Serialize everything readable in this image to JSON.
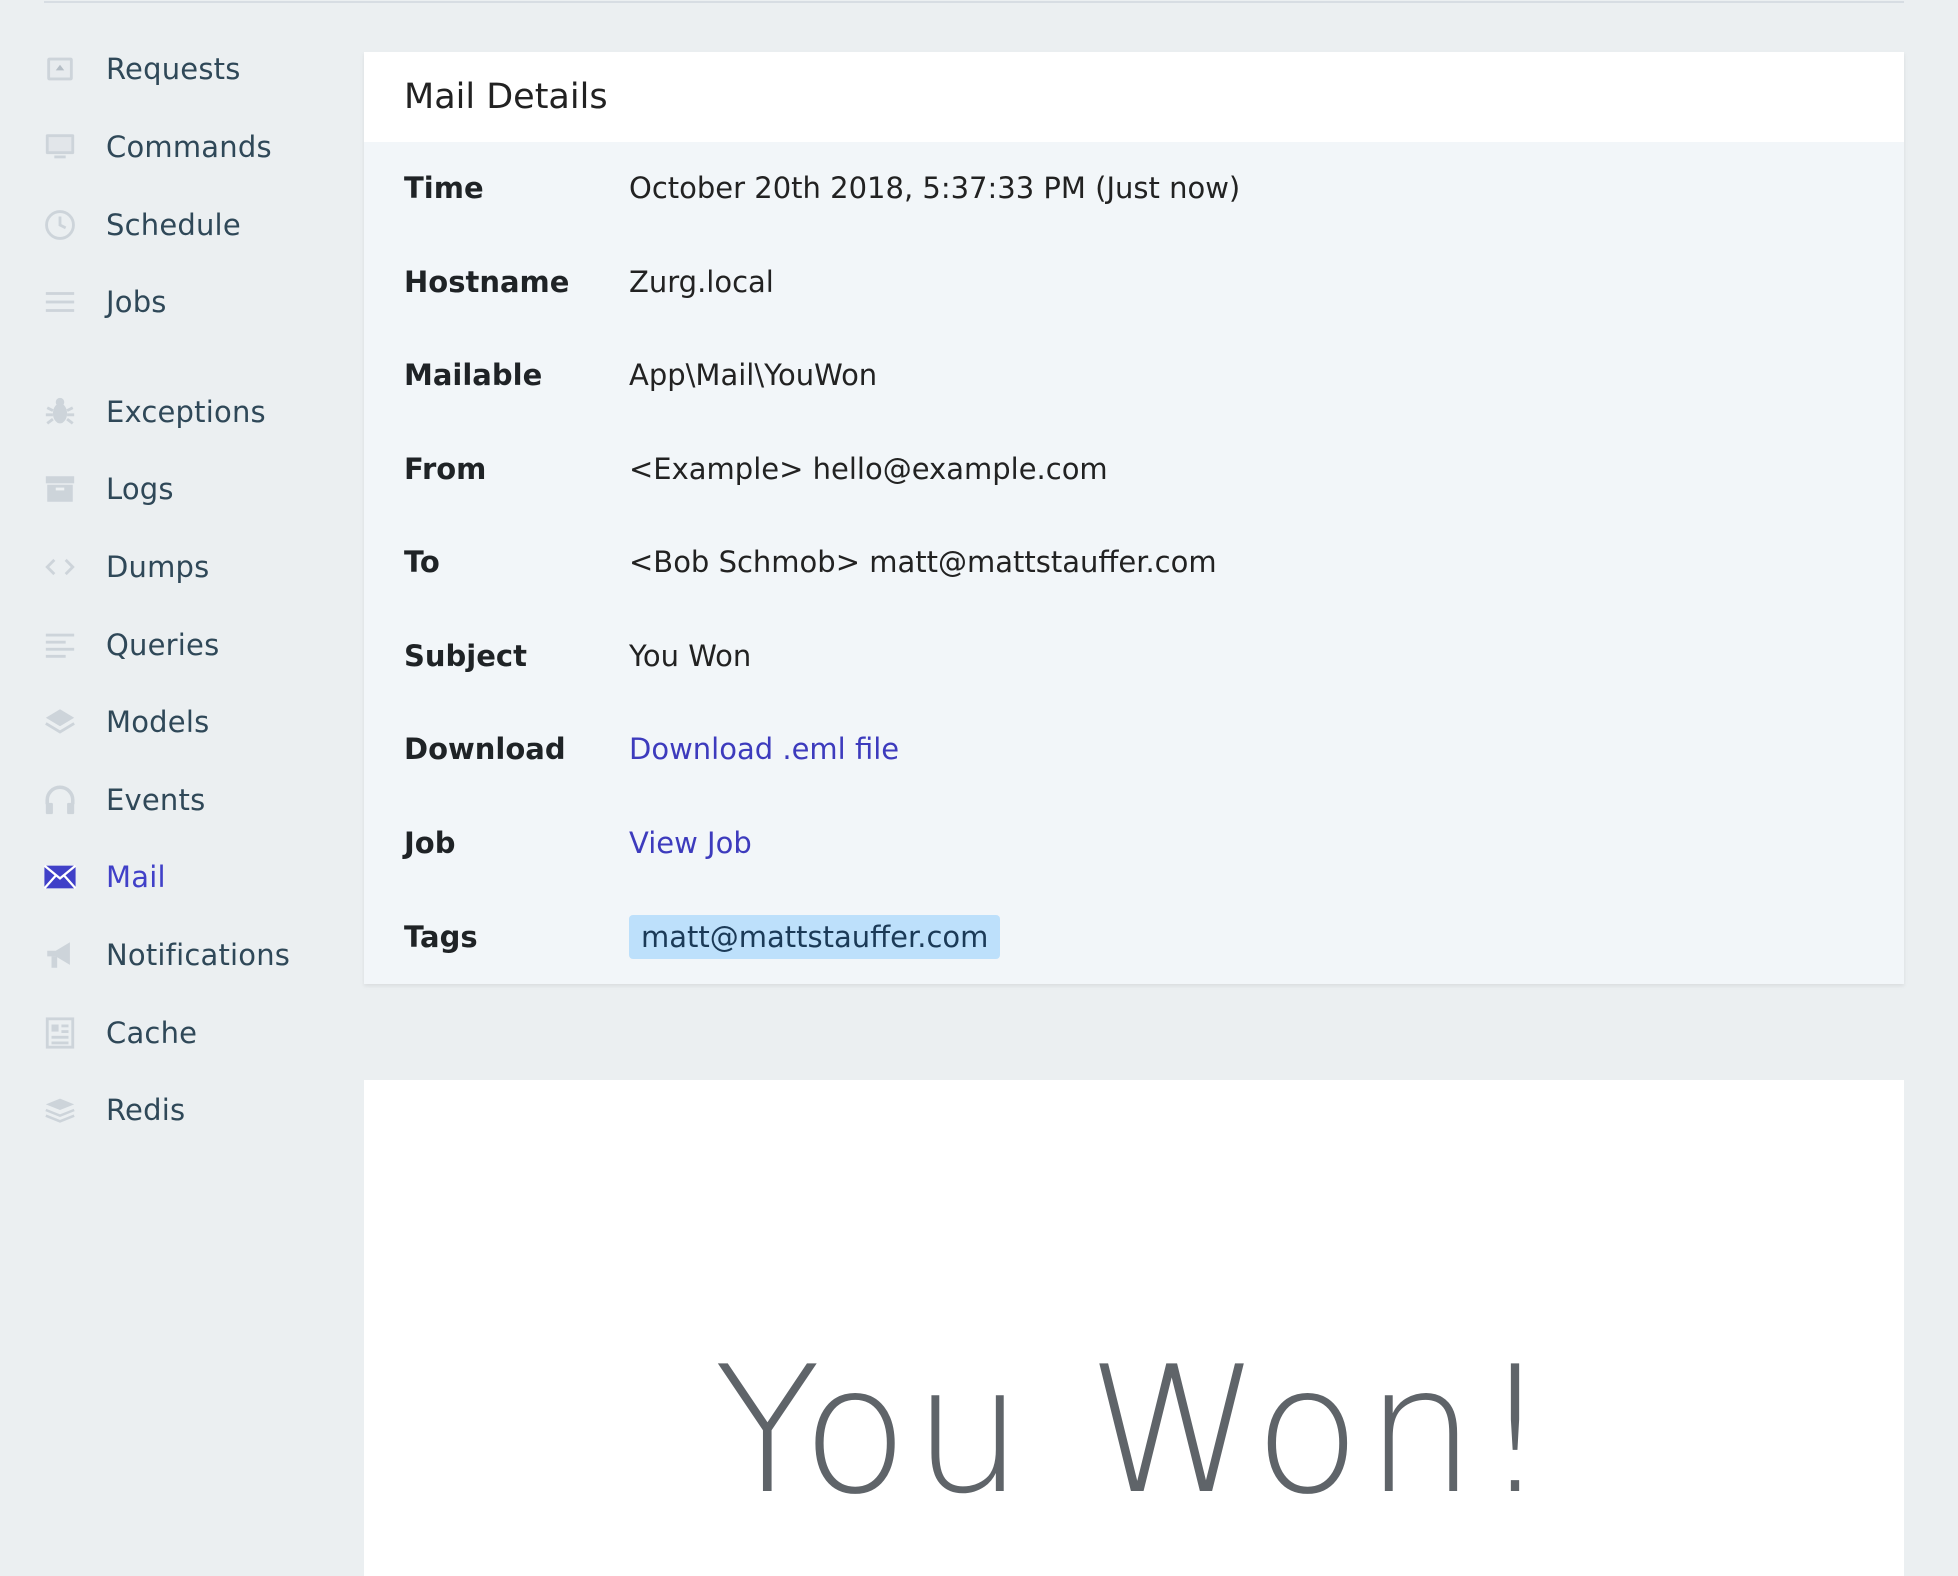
{
  "sidebar": {
    "items": [
      {
        "label": "Requests",
        "icon": "requests-icon"
      },
      {
        "label": "Commands",
        "icon": "monitor-icon"
      },
      {
        "label": "Schedule",
        "icon": "clock-icon"
      },
      {
        "label": "Jobs",
        "icon": "list-icon"
      },
      {
        "label": "Exceptions",
        "icon": "bug-icon"
      },
      {
        "label": "Logs",
        "icon": "archive-icon"
      },
      {
        "label": "Dumps",
        "icon": "code-icon"
      },
      {
        "label": "Queries",
        "icon": "lines-icon"
      },
      {
        "label": "Models",
        "icon": "layers-icon"
      },
      {
        "label": "Events",
        "icon": "headphones-icon"
      },
      {
        "label": "Mail",
        "icon": "envelope-icon",
        "active": true
      },
      {
        "label": "Notifications",
        "icon": "megaphone-icon"
      },
      {
        "label": "Cache",
        "icon": "document-icon"
      },
      {
        "label": "Redis",
        "icon": "stack-icon"
      }
    ]
  },
  "details": {
    "title": "Mail Details",
    "rows": [
      {
        "key": "Time",
        "value": "October 20th 2018, 5:37:33 PM (Just now)"
      },
      {
        "key": "Hostname",
        "value": "Zurg.local"
      },
      {
        "key": "Mailable",
        "value": "App\\Mail\\YouWon"
      },
      {
        "key": "From",
        "value": "<Example> hello@example.com"
      },
      {
        "key": "To",
        "value": "<Bob Schmob> matt@mattstauffer.com"
      },
      {
        "key": "Subject",
        "value": "You Won"
      },
      {
        "key": "Download",
        "value": "Download .eml file"
      },
      {
        "key": "Job",
        "value": "View Job"
      },
      {
        "key": "Tags",
        "value": "matt@mattstauffer.com"
      }
    ]
  },
  "preview": {
    "heading": "You Won!"
  },
  "colors": {
    "accent": "#4040c8",
    "link": "#3d3bbd",
    "tag_bg": "#bde0fb",
    "page_bg": "#ebeff1"
  }
}
